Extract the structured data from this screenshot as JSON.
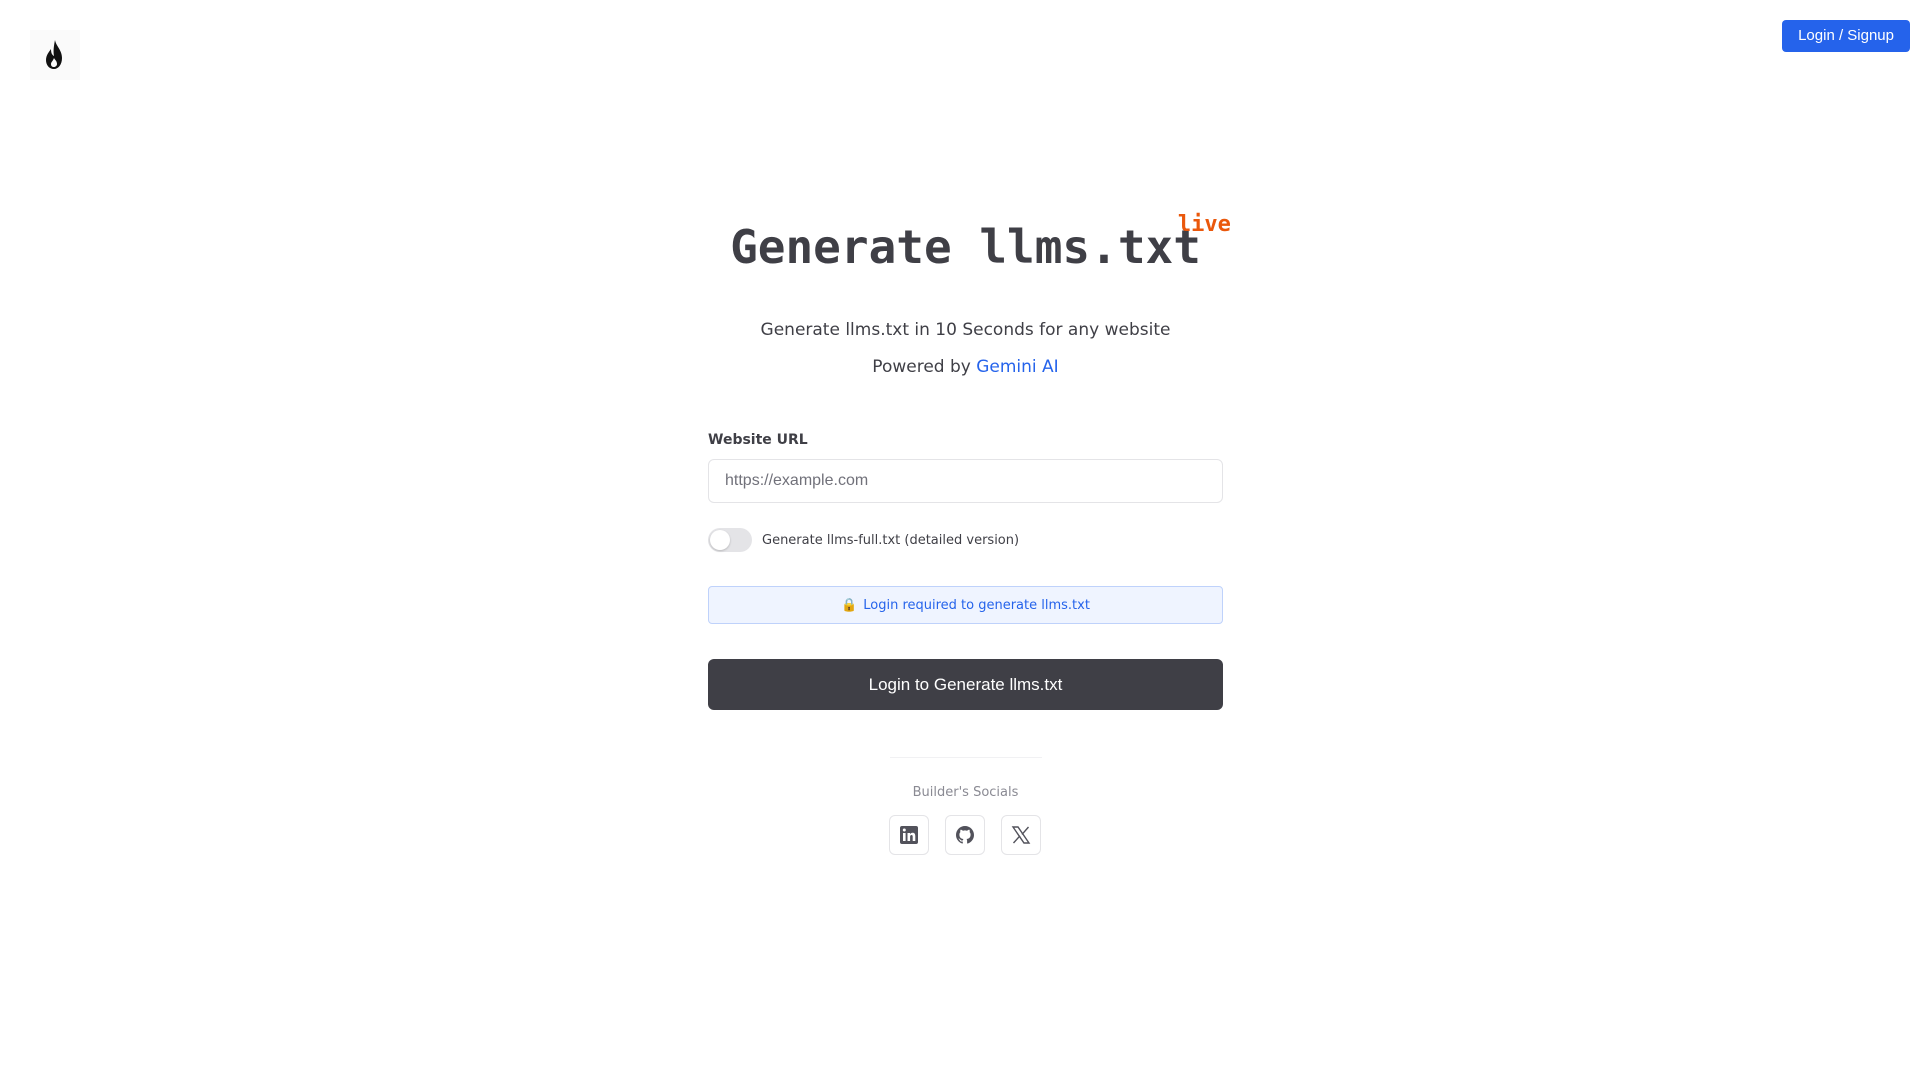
{
  "header": {
    "logo_icon": "flame-icon",
    "login_label": "Login / Signup"
  },
  "hero": {
    "title": "Generate llms.txt",
    "badge": "live",
    "subtitle": "Generate llms.txt in 10 Seconds for any website",
    "powered_prefix": "Powered by ",
    "powered_link": "Gemini AI"
  },
  "form": {
    "url_label": "Website URL",
    "url_placeholder": "https://example.com",
    "url_value": "",
    "toggle_label": "Generate llms-full.txt (detailed version)",
    "toggle_on": false,
    "notice_icon": "lock-icon",
    "notice_text": "Login required to generate llms.txt",
    "submit_label": "Login to Generate llms.txt"
  },
  "footer": {
    "socials_label": "Builder's Socials",
    "socials": [
      {
        "icon": "linkedin-icon"
      },
      {
        "icon": "github-icon"
      },
      {
        "icon": "x-icon"
      }
    ]
  },
  "colors": {
    "accent": "#2563eb",
    "badge": "#ea580c",
    "primary_button": "#3f3f46"
  }
}
